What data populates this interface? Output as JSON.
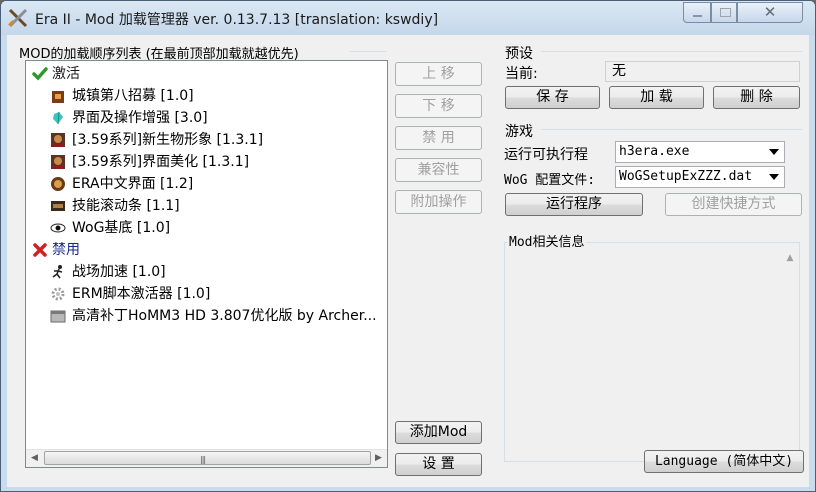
{
  "window": {
    "title": "Era II - Mod 加载管理器 ver. 0.13.7.13 [translation: kswdiy]",
    "close_glyph": "✕"
  },
  "left_panel": {
    "title": "MOD的加载顺序列表 (在最前顶部加载就越优先)"
  },
  "tree": {
    "enabled_group": {
      "label": "激活",
      "icon": "check-icon",
      "color": "#2e9a2e"
    },
    "enabled_items": [
      {
        "label": "城镇第八招募 [1.0]",
        "icon": "castle-icon"
      },
      {
        "label": "界面及操作增强 [3.0]",
        "icon": "crystal-icon"
      },
      {
        "label": "[3.59系列]新生物形象 [1.3.1]",
        "icon": "creature-portrait-icon"
      },
      {
        "label": "[3.59系列]界面美化 [1.3.1]",
        "icon": "creature-portrait-icon"
      },
      {
        "label": "ERA中文界面 [1.2]",
        "icon": "shield-icon"
      },
      {
        "label": "技能滚动条 [1.1]",
        "icon": "scrollbar-icon"
      },
      {
        "label": "WoG基底 [1.0]",
        "icon": "eye-icon"
      }
    ],
    "disabled_group": {
      "label": "禁用",
      "icon": "cross-icon",
      "color": "#d22020"
    },
    "disabled_items": [
      {
        "label": "战场加速 [1.0]",
        "icon": "runner-icon"
      },
      {
        "label": "ERM脚本激活器 [1.0]",
        "icon": "gear-icon"
      },
      {
        "label": "高清补丁HoMM3 HD 3.807优化版 by Archer...",
        "icon": "window-icon"
      }
    ]
  },
  "middle_buttons": {
    "move_up": "上 移",
    "move_down": "下 移",
    "disable": "禁 用",
    "compat": "兼容性",
    "extra_ops": "附加操作",
    "add_mod": "添加Mod",
    "settings": "设 置"
  },
  "presets": {
    "title": "预设",
    "current_label": "当前:",
    "current_value": "无",
    "save": "保 存",
    "load": "加 载",
    "delete": "删 除"
  },
  "game": {
    "title": "游戏",
    "exe_label": "运行可执行程",
    "exe_value": "h3era.exe",
    "config_label": "WoG 配置文件:",
    "config_value": "WoGSetupExZZZ.dat",
    "run": "运行程序",
    "shortcut": "创建快捷方式"
  },
  "info": {
    "title": "Mod相关信息"
  },
  "language_button": "Language (简体中文)"
}
